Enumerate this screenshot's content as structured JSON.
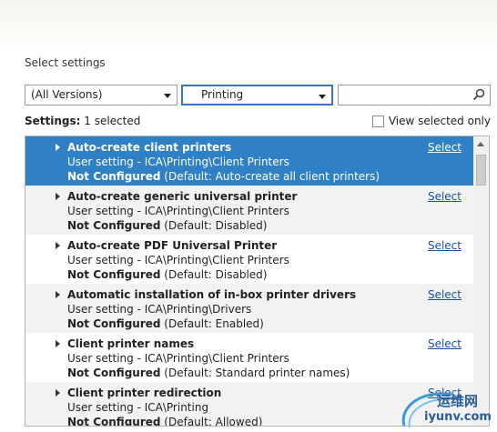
{
  "section_title": "Select settings",
  "filters": {
    "version": "(All Versions)",
    "category": "Printing",
    "search_placeholder": ""
  },
  "status": {
    "label": "Settings:",
    "count": "1 selected",
    "view_selected_only": "View selected only",
    "view_selected_only_checked": false
  },
  "settings": [
    {
      "title": "Auto-create client printers",
      "path": "User setting - ICA\\Printing\\Client Printers",
      "status_bold": "Not Configured",
      "status_rest": " (Default: Auto-create all client printers)",
      "action": "Select",
      "selected": true
    },
    {
      "title": "Auto-create generic universal printer",
      "path": "User setting - ICA\\Printing\\Client Printers",
      "status_bold": "Not Configured",
      "status_rest": " (Default: Disabled)",
      "action": "Select",
      "selected": false
    },
    {
      "title": "Auto-create PDF Universal Printer",
      "path": "User setting - ICA\\Printing\\Client Printers",
      "status_bold": "Not Configured",
      "status_rest": " (Default: Disabled)",
      "action": "Select",
      "selected": false
    },
    {
      "title": "Automatic installation of in-box printer drivers",
      "path": "User setting - ICA\\Printing\\Drivers",
      "status_bold": "Not Configured",
      "status_rest": " (Default: Enabled)",
      "action": "Select",
      "selected": false
    },
    {
      "title": "Client printer names",
      "path": "User setting - ICA\\Printing\\Client Printers",
      "status_bold": "Not Configured",
      "status_rest": " (Default: Standard printer names)",
      "action": "Select",
      "selected": false
    },
    {
      "title": "Client printer redirection",
      "path": "User setting - ICA\\Printing",
      "status_bold": "Not Configured",
      "status_rest": " (Default: Allowed)",
      "action": "Select",
      "selected": false
    }
  ],
  "watermark": {
    "line1": "运维网",
    "line2": "iyunv.com"
  },
  "colors": {
    "selected_row": "#2f80c4",
    "link": "#1a50a0",
    "alt_row": "#f2f2f2"
  }
}
